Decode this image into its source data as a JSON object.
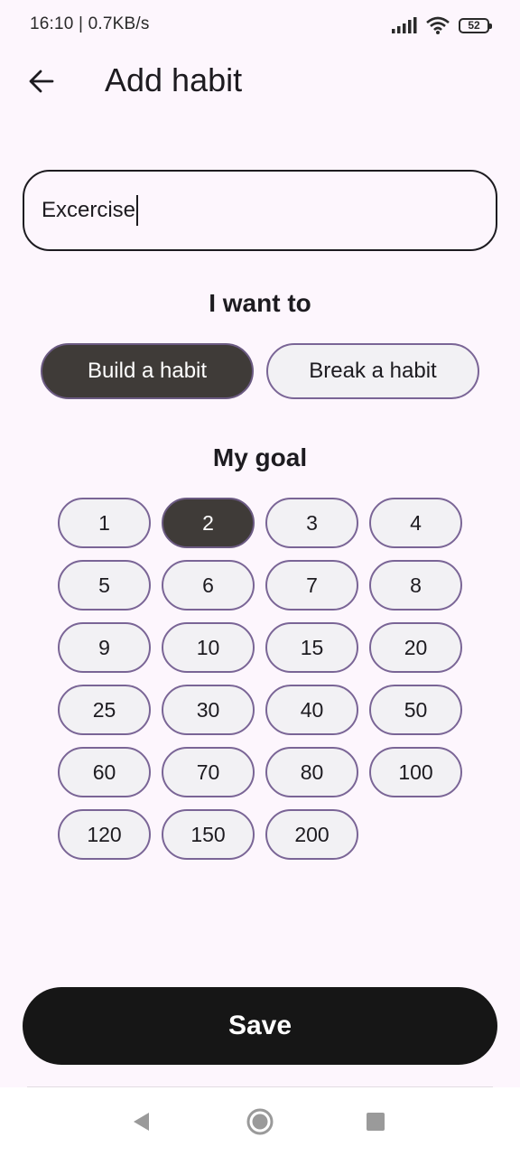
{
  "status_bar": {
    "time_speed": "16:10 | 0.7KB/s",
    "battery": "52"
  },
  "header": {
    "back_icon": "arrow-left-icon",
    "title": "Add habit"
  },
  "name_input": {
    "value": "Excercise"
  },
  "habit_type": {
    "heading": "I want to",
    "options": [
      "Build a habit",
      "Break a habit"
    ],
    "selected": "Build a habit"
  },
  "goal": {
    "heading": "My goal",
    "options": [
      "1",
      "2",
      "3",
      "4",
      "5",
      "6",
      "7",
      "8",
      "9",
      "10",
      "15",
      "20",
      "25",
      "30",
      "40",
      "50",
      "60",
      "70",
      "80",
      "100",
      "120",
      "150",
      "200"
    ],
    "selected": "2"
  },
  "save_label": "Save",
  "nav": {
    "back_icon": "triangle-back-icon",
    "home_icon": "circle-home-icon",
    "recents_icon": "square-recents-icon"
  },
  "colors": {
    "background": "#fdf6fd",
    "selected_pill": "#3f3b38",
    "pill": "#f2f1f4",
    "pill_border": "#7a6596",
    "save_button": "#161616"
  }
}
